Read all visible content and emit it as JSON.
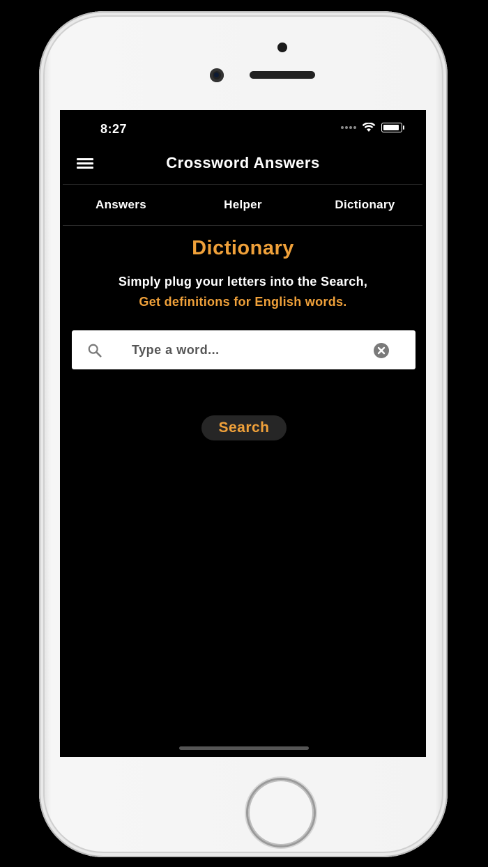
{
  "status_bar": {
    "time": "8:27"
  },
  "app_bar": {
    "title": "Crossword Answers",
    "menu_icon": "hamburger-menu-icon"
  },
  "tabs": [
    {
      "label": "Answers"
    },
    {
      "label": "Helper"
    },
    {
      "label": "Dictionary"
    }
  ],
  "main": {
    "heading": "Dictionary",
    "subtitle_line1": "Simply plug your letters into the Search,",
    "subtitle_line2": "Get definitions for English words.",
    "search": {
      "placeholder": "Type a word...",
      "value": ""
    },
    "search_button_label": "Search"
  },
  "colors": {
    "accent": "#f0a13a",
    "background": "#000000",
    "button_bg": "#262626"
  }
}
